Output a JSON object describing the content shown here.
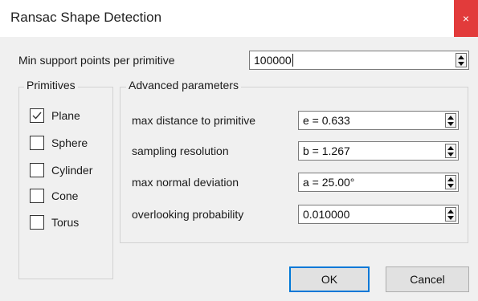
{
  "window": {
    "title": "Ransac Shape Detection",
    "close_label": "×"
  },
  "min_support": {
    "label": "Min support points per primitive",
    "value": "100000"
  },
  "primitives": {
    "title": "Primitives",
    "items": [
      {
        "label": "Plane",
        "checked": true
      },
      {
        "label": "Sphere",
        "checked": false
      },
      {
        "label": "Cylinder",
        "checked": false
      },
      {
        "label": "Cone",
        "checked": false
      },
      {
        "label": "Torus",
        "checked": false
      }
    ]
  },
  "advanced": {
    "title": "Advanced parameters",
    "params": [
      {
        "label": "max distance to primitive",
        "value": "e = 0.633"
      },
      {
        "label": "sampling resolution",
        "value": "b = 1.267"
      },
      {
        "label": "max normal deviation",
        "value": "a = 25.00°"
      },
      {
        "label": "overlooking probability",
        "value": "0.010000"
      }
    ]
  },
  "buttons": {
    "ok": "OK",
    "cancel": "Cancel"
  },
  "colors": {
    "close_bg": "#e23b3b",
    "default_button_border": "#0078d7",
    "dialog_bg": "#f0f0f0"
  }
}
